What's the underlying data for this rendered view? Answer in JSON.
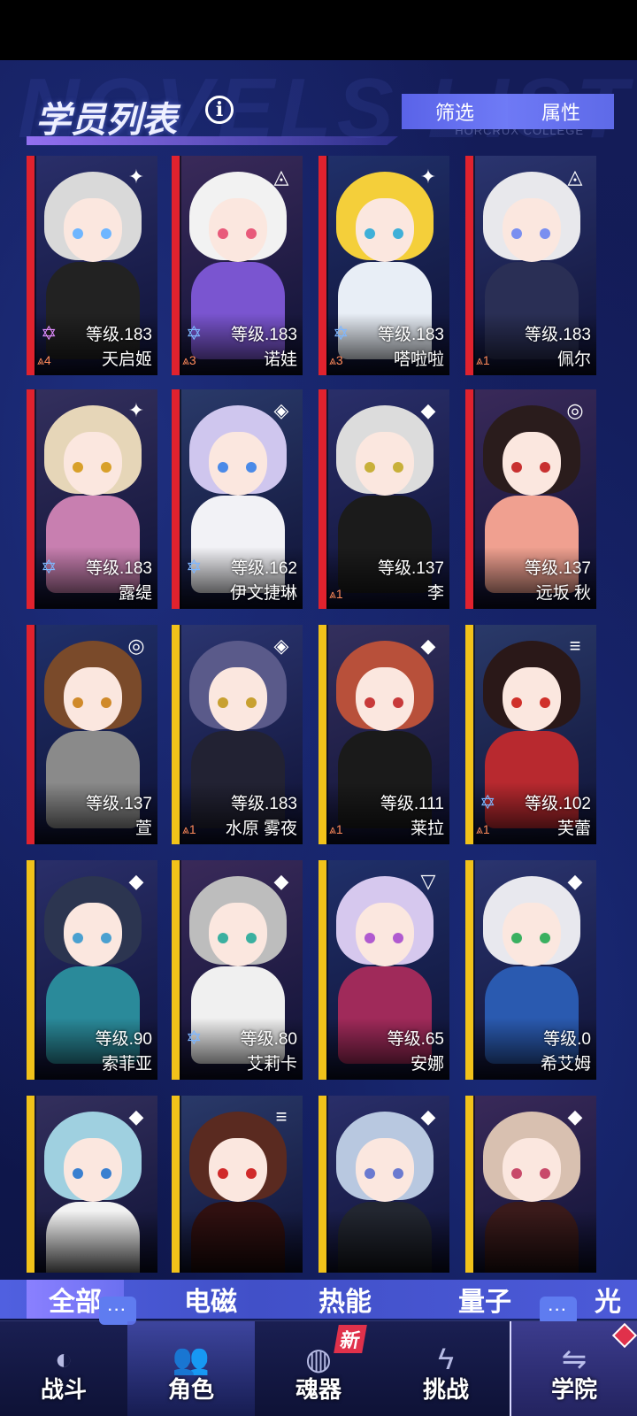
{
  "header": {
    "title": "学员列表",
    "info_icon": "i",
    "filter_label": "筛选",
    "attr_label": "属性",
    "watermark": "NOVELS LIST",
    "college": "HORCRUX COLLEGE"
  },
  "cards": [
    {
      "level": "等级.183",
      "name": "天启姬",
      "rank": "4",
      "stripe": "#e0222e",
      "hair": "#d9d9d9",
      "body": "#222",
      "eye": "#6fb6ff",
      "corner": "✦",
      "star": "pink"
    },
    {
      "level": "等级.183",
      "name": "诺娃",
      "rank": "3",
      "stripe": "#e0222e",
      "hair": "#f2f2f2",
      "body": "#7a55d0",
      "eye": "#e85a7a",
      "corner": "◬",
      "star": "blue"
    },
    {
      "level": "等级.183",
      "name": "嗒啦啦",
      "rank": "3",
      "stripe": "#e0222e",
      "hair": "#f4cf3a",
      "body": "#e8eef6",
      "eye": "#3fb0d8",
      "corner": "✦",
      "star": "blue"
    },
    {
      "level": "等级.183",
      "name": "佩尔",
      "rank": "1",
      "stripe": "#e0222e",
      "hair": "#e8e8ec",
      "body": "#2a2f55",
      "eye": "#7a8ff0",
      "corner": "◬",
      "star": ""
    },
    {
      "level": "等级.183",
      "name": "露缇",
      "rank": "",
      "stripe": "#e0222e",
      "hair": "#e6d6b8",
      "body": "#c87fb0",
      "eye": "#d8a02a",
      "corner": "✦",
      "star": "blue"
    },
    {
      "level": "等级.162",
      "name": "伊文捷琳",
      "rank": "",
      "stripe": "#e0222e",
      "hair": "#cfc6ee",
      "body": "#f2f2f6",
      "eye": "#4a8ae8",
      "corner": "◈",
      "star": "blue"
    },
    {
      "level": "等级.137",
      "name": "李",
      "rank": "1",
      "stripe": "#e0222e",
      "hair": "#dcdcdc",
      "body": "#1b1b1b",
      "eye": "#c8b03a",
      "corner": "◆",
      "star": ""
    },
    {
      "level": "等级.137",
      "name": "远坂 秋",
      "rank": "",
      "stripe": "#e0222e",
      "hair": "#2a1c1c",
      "body": "#f0a090",
      "eye": "#c83030",
      "corner": "◎",
      "star": ""
    },
    {
      "level": "等级.137",
      "name": "萱",
      "rank": "",
      "stripe": "#e0222e",
      "hair": "#7a4a2a",
      "body": "#8a8a8a",
      "eye": "#d08a2a",
      "corner": "◎",
      "star": ""
    },
    {
      "level": "等级.183",
      "name": "水原 雾夜",
      "rank": "1",
      "stripe": "#f1c21a",
      "hair": "#5a5a8a",
      "body": "#222233",
      "eye": "#c8a030",
      "corner": "◈",
      "star": ""
    },
    {
      "level": "等级.111",
      "name": "莱拉",
      "rank": "1",
      "stripe": "#f1c21a",
      "hair": "#b8503a",
      "body": "#1a1a1a",
      "eye": "#c83a3a",
      "corner": "◆",
      "star": ""
    },
    {
      "level": "等级.102",
      "name": "芙蕾",
      "rank": "1",
      "stripe": "#f1c21a",
      "hair": "#2a1818",
      "body": "#b8292f",
      "eye": "#d0302a",
      "corner": "≡",
      "star": "blue"
    },
    {
      "level": "等级.90",
      "name": "索菲亚",
      "rank": "",
      "stripe": "#f1c21a",
      "hair": "#2c3550",
      "body": "#2a8a9a",
      "eye": "#4aa0d0",
      "corner": "◆",
      "star": ""
    },
    {
      "level": "等级.80",
      "name": "艾莉卡",
      "rank": "",
      "stripe": "#f1c21a",
      "hair": "#bdbdbd",
      "body": "#f0f0f0",
      "eye": "#3ab0a0",
      "corner": "◆",
      "star": "blue"
    },
    {
      "level": "等级.65",
      "name": "安娜",
      "rank": "",
      "stripe": "#f1c21a",
      "hair": "#d6c8ee",
      "body": "#a02a5a",
      "eye": "#b05ad0",
      "corner": "▽",
      "star": ""
    },
    {
      "level": "等级.0",
      "name": "希艾姆",
      "rank": "",
      "stripe": "#f1c21a",
      "hair": "#e8e8ee",
      "body": "#2a5ab0",
      "eye": "#3ab060",
      "corner": "◆",
      "star": ""
    },
    {
      "level": "",
      "name": "",
      "rank": "",
      "stripe": "#f1c21a",
      "hair": "#9fd0e0",
      "body": "#f2f2f2",
      "eye": "#3a80d0",
      "corner": "◆",
      "star": ""
    },
    {
      "level": "",
      "name": "",
      "rank": "",
      "stripe": "#f1c21a",
      "hair": "#5a2a20",
      "body": "#301010",
      "eye": "#d02a2a",
      "corner": "≡",
      "star": ""
    },
    {
      "level": "",
      "name": "",
      "rank": "",
      "stripe": "#f1c21a",
      "hair": "#b8c8e0",
      "body": "#222630",
      "eye": "#6a7ad0",
      "corner": "◆",
      "star": ""
    },
    {
      "level": "",
      "name": "",
      "rank": "",
      "stripe": "#f1c21a",
      "hair": "#d8c0b0",
      "body": "#3a1a1a",
      "eye": "#c84a6a",
      "corner": "◆",
      "star": ""
    }
  ],
  "filters": [
    {
      "label": "全部",
      "active": true
    },
    {
      "label": "电磁",
      "active": false
    },
    {
      "label": "热能",
      "active": false
    },
    {
      "label": "量子",
      "active": false
    },
    {
      "label": "光",
      "active": false
    }
  ],
  "tabs": [
    {
      "label": "战斗",
      "icon": "globe-icon"
    },
    {
      "label": "角色",
      "icon": "users-icon"
    },
    {
      "label": "魂器",
      "icon": "relic-icon",
      "badge": "新"
    },
    {
      "label": "挑战",
      "icon": "bolt-icon"
    },
    {
      "label": "学院",
      "icon": "swap-icon"
    }
  ],
  "chat_dots": "···"
}
